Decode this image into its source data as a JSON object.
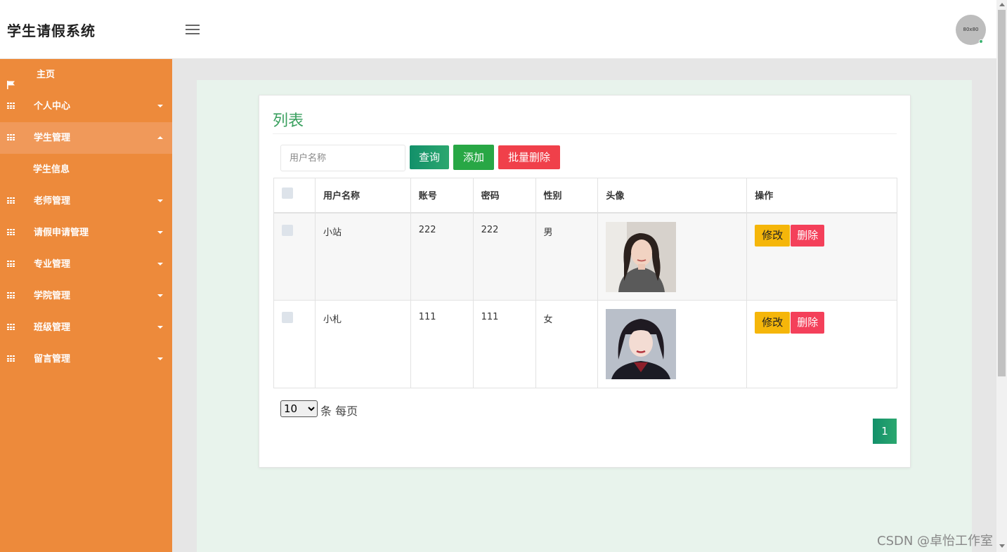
{
  "app": {
    "title": "学生请假系统",
    "avatar_text": "80x80"
  },
  "sidebar": {
    "items": [
      {
        "label": "主页",
        "icon": "flag-icon"
      },
      {
        "label": "个人中心",
        "icon": "grid-icon"
      },
      {
        "label": "学生管理",
        "icon": "grid-icon",
        "expanded": true,
        "children": [
          {
            "label": "学生信息"
          }
        ]
      },
      {
        "label": "老师管理",
        "icon": "grid-icon"
      },
      {
        "label": "请假申请管理",
        "icon": "grid-icon"
      },
      {
        "label": "专业管理",
        "icon": "grid-icon"
      },
      {
        "label": "学院管理",
        "icon": "grid-icon"
      },
      {
        "label": "班级管理",
        "icon": "grid-icon"
      },
      {
        "label": "留言管理",
        "icon": "grid-icon"
      }
    ]
  },
  "main": {
    "title": "列表",
    "search": {
      "placeholder": "用户名称",
      "value": ""
    },
    "buttons": {
      "query": "查询",
      "add": "添加",
      "batch_delete": "批量删除"
    },
    "table": {
      "headers": [
        "用户名称",
        "账号",
        "密码",
        "性别",
        "头像",
        "操作"
      ],
      "rows": [
        {
          "name": "小站",
          "account": "222",
          "password": "222",
          "gender": "男",
          "avatar": "female-portrait-1",
          "edit": "修改",
          "delete": "删除"
        },
        {
          "name": "小札",
          "account": "111",
          "password": "111",
          "gender": "女",
          "avatar": "female-portrait-2",
          "edit": "修改",
          "delete": "删除"
        }
      ]
    },
    "pagination": {
      "page_size": "10",
      "page_size_label": "条 每页",
      "current_page": "1"
    }
  },
  "watermark": "CSDN @卓怡工作室",
  "colors": {
    "sidebar": "#ed8a3b",
    "sidebar_active": "#f0995a",
    "accent_green": "#3aa05f",
    "danger": "#f0404a",
    "warning": "#f5b60a",
    "content_bg": "#e8f3ec"
  }
}
